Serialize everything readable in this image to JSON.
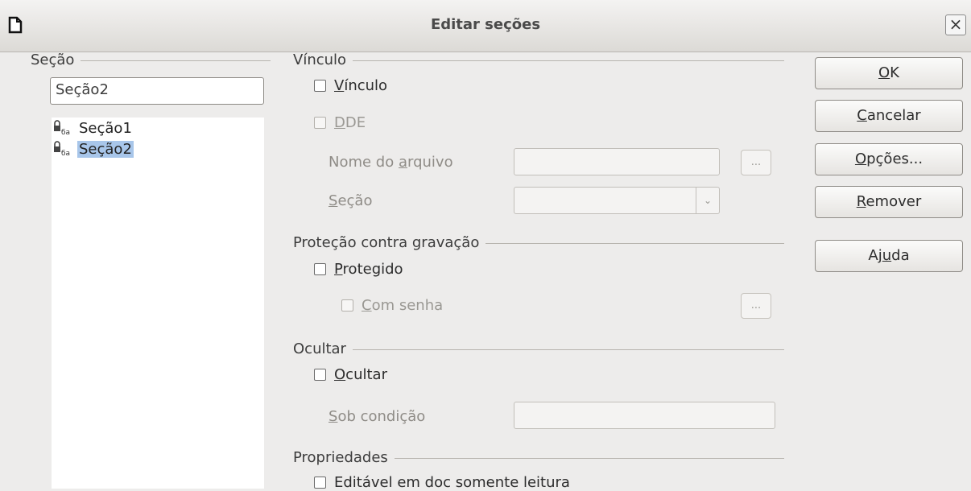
{
  "window": {
    "title": "Editar seções",
    "close_glyph": "×",
    "app_icon": "document-icon"
  },
  "sections": {
    "heading": "Seção",
    "name_value": "Seção2",
    "items": [
      {
        "label": "Seção1",
        "selected": false
      },
      {
        "label": "Seção2",
        "selected": true
      }
    ]
  },
  "link": {
    "heading": "Vínculo",
    "link_checkbox": {
      "pre": "",
      "mn": "V",
      "post": "ínculo",
      "checked": false
    },
    "dde_checkbox": {
      "pre": "",
      "mn": "D",
      "post": "DE",
      "checked": false
    },
    "filename_label": {
      "pre": "Nome do ",
      "mn": "a",
      "post": "rquivo"
    },
    "filename_value": "",
    "browse_label": "...",
    "section_label": {
      "pre": "",
      "mn": "S",
      "post": "eção"
    },
    "section_value": ""
  },
  "protection": {
    "heading": "Proteção contra gravação",
    "protected_checkbox": {
      "pre": "",
      "mn": "P",
      "post": "rotegido",
      "checked": false
    },
    "password_checkbox": {
      "pre": "",
      "mn": "C",
      "post": "om senha",
      "checked": false
    },
    "password_button_label": "..."
  },
  "hide": {
    "heading": "Ocultar",
    "hide_checkbox": {
      "pre": "",
      "mn": "O",
      "post": "cultar",
      "checked": false
    },
    "condition_label": {
      "pre": "",
      "mn": "S",
      "post": "ob condição"
    },
    "condition_value": ""
  },
  "properties": {
    "heading": "Propriedades",
    "editable_checkbox": {
      "label": "Editável em doc somente leitura",
      "checked": false
    }
  },
  "buttons": {
    "ok": {
      "pre": "",
      "mn": "O",
      "post": "K"
    },
    "cancel": {
      "pre": "",
      "mn": "C",
      "post": "ancelar"
    },
    "options": {
      "pre": "",
      "mn": "O",
      "post": "pções..."
    },
    "remove": {
      "pre": "",
      "mn": "R",
      "post": "emover"
    },
    "help": {
      "pre": "Aj",
      "mn": "u",
      "post": "da"
    }
  }
}
